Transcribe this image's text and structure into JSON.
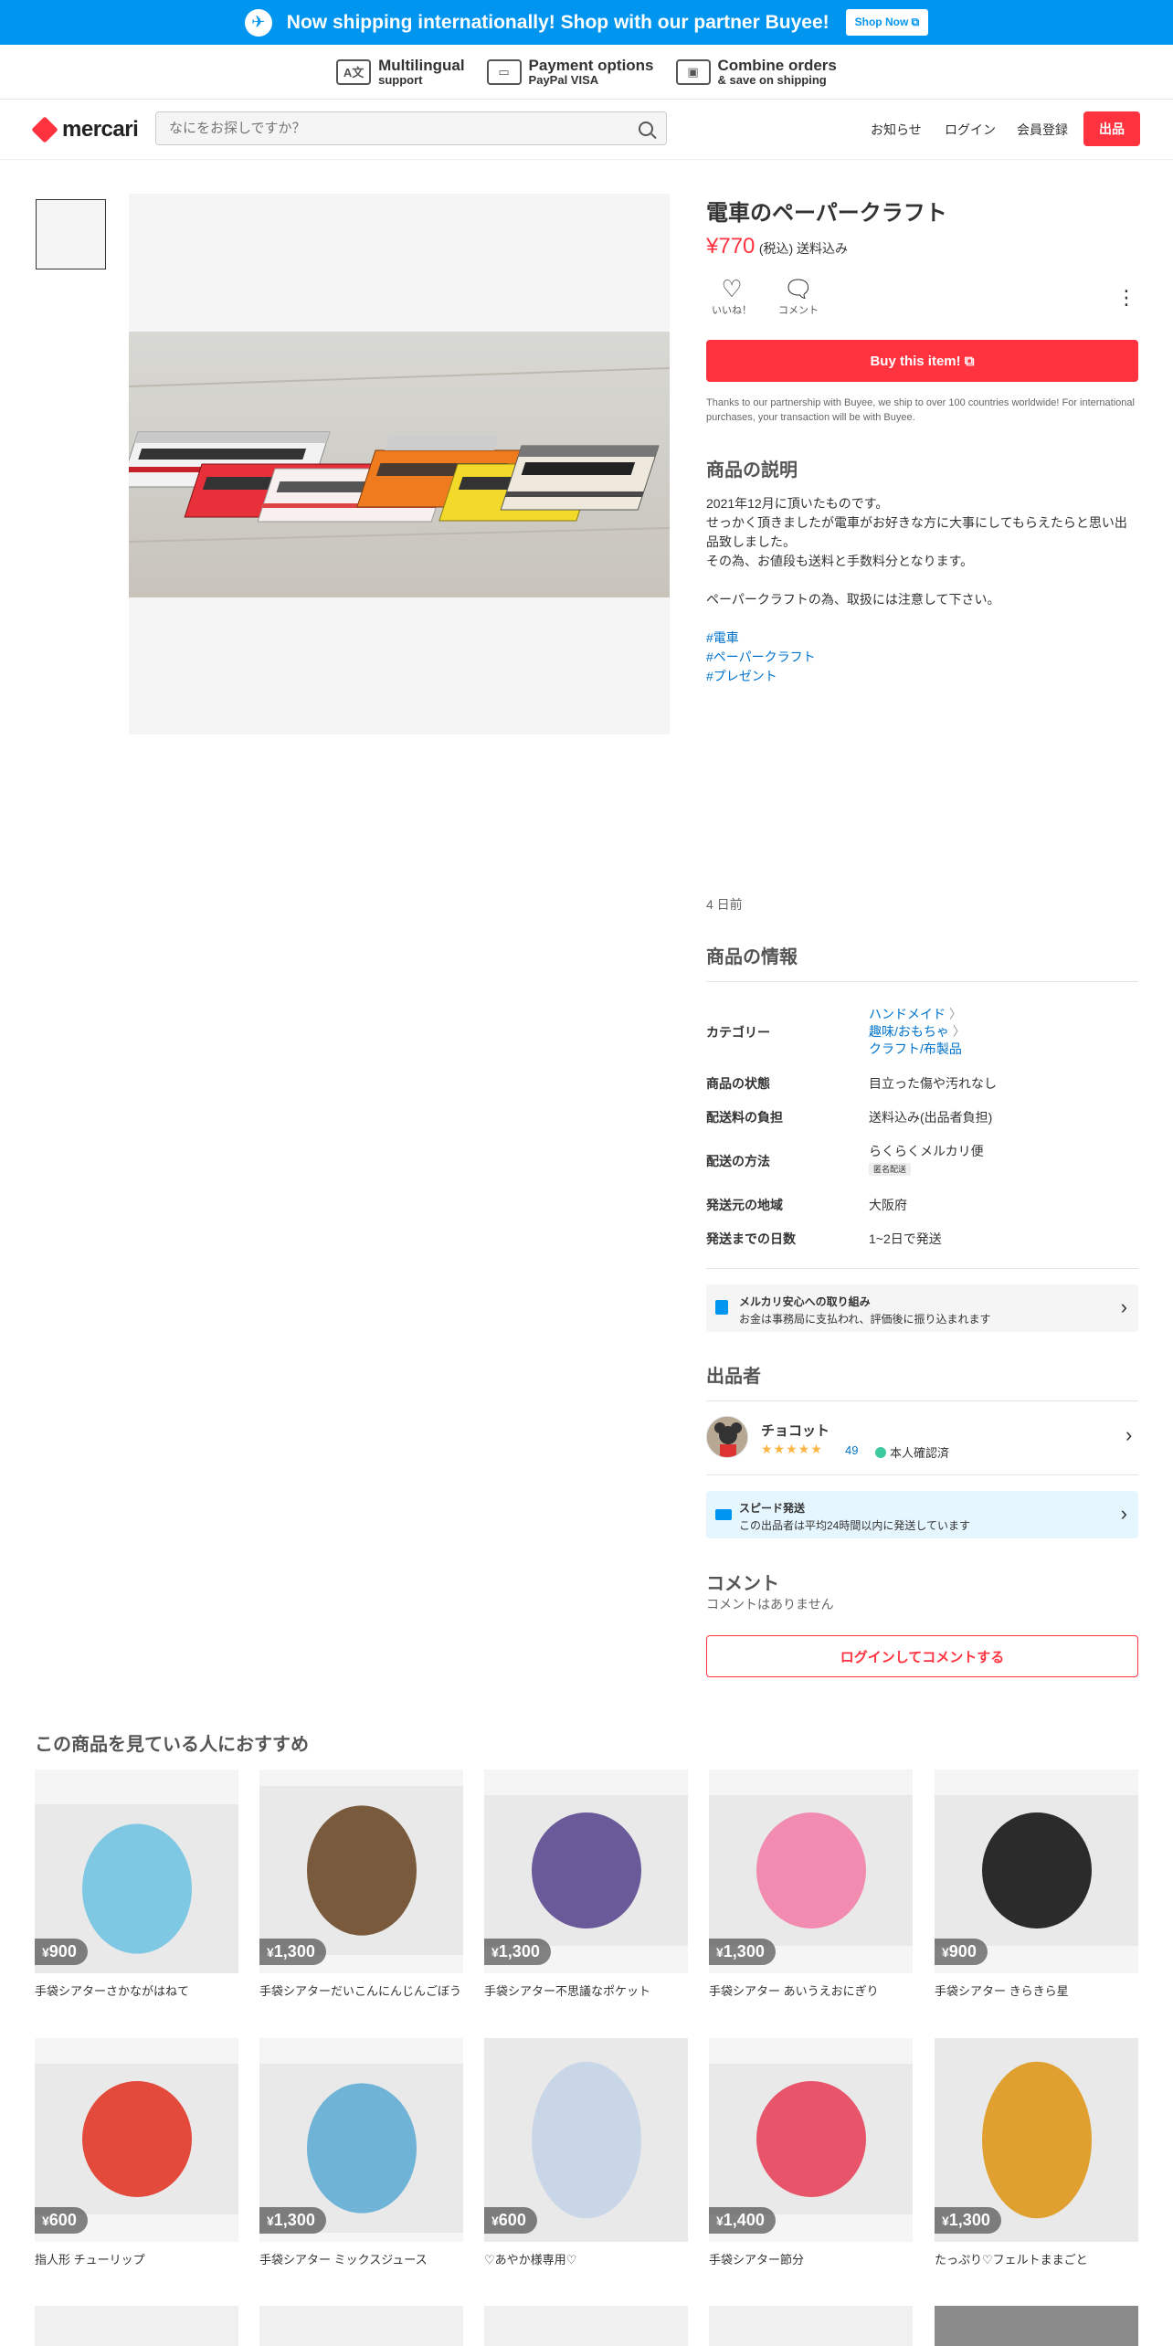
{
  "banner": {
    "message": "Now shipping internationally! Shop with our partner Buyee!",
    "shop_now": "Shop Now"
  },
  "features": [
    {
      "title": "Multilingual",
      "sub": "support",
      "icon": "language-icon",
      "glyph": "A文"
    },
    {
      "title": "Payment options",
      "sub": "PayPal VISA",
      "icon": "payment-icon",
      "glyph": "▭"
    },
    {
      "title": "Combine orders",
      "sub": "& save on shipping",
      "icon": "box-icon",
      "glyph": "▣"
    }
  ],
  "header": {
    "logo": "mercari",
    "search_placeholder": "なにをお探しですか？",
    "nav": [
      "お知らせ",
      "ログイン",
      "会員登録"
    ],
    "sell": "出品"
  },
  "item": {
    "title": "電車のペーパークラフト",
    "price": "¥770",
    "tax": "(税込) 送料込み",
    "like": "いいね！",
    "comment": "コメント",
    "buy": "Buy this item!",
    "note": "Thanks to our partnership with Buyee, we ship to over 100 countries worldwide! For international purchases, your transaction will be with Buyee.",
    "desc_heading": "商品の説明",
    "description": "2021年12月に頂いたものです。\nせっかく頂きましたが電車がお好きな方に大事にしてもらえたらと思い出品致しました。\nその為、お値段も送料と手数料分となります。\n\nペーパークラフトの為、取扱には注意して下さい。",
    "tags": [
      "#電車",
      "#ペーパークラフト",
      "#プレゼント"
    ],
    "posted": "4 日前",
    "info_heading": "商品の情報",
    "category_label": "カテゴリー",
    "categories": [
      "ハンドメイド",
      "趣味/おもちゃ",
      "クラフト/布製品"
    ],
    "info": [
      {
        "label": "商品の状態",
        "value": "目立った傷や汚れなし"
      },
      {
        "label": "配送料の負担",
        "value": "送料込み(出品者負担)"
      },
      {
        "label": "配送の方法",
        "value": "らくらくメルカリ便",
        "pill": "匿名配送"
      },
      {
        "label": "発送元の地域",
        "value": "大阪府"
      },
      {
        "label": "発送までの日数",
        "value": "1~2日で発送"
      }
    ]
  },
  "safety": {
    "title": "メルカリ安心への取り組み",
    "text": "お金は事務局に支払われ、評価後に振り込まれます"
  },
  "seller": {
    "heading": "出品者",
    "name": "チョコット",
    "stars": "★★★★★",
    "rating": "49",
    "verified": "本人確認済"
  },
  "speed": {
    "title": "スピード発送",
    "text": "この出品者は平均24時間以内に発送しています"
  },
  "comments": {
    "heading": "コメント",
    "empty": "コメントはありません",
    "button": "ログインしてコメントする"
  },
  "recommend": {
    "heading": "この商品を見ている人におすすめ",
    "items": [
      {
        "price": "900",
        "name": "手袋シアターさかながはねて",
        "color": "#7ec8e3"
      },
      {
        "price": "1,300",
        "name": "手袋シアターだいこんにんじんごぼう",
        "color": "#7a5a3c"
      },
      {
        "price": "1,300",
        "name": "手袋シアター不思議なポケット",
        "color": "#6a5a9a"
      },
      {
        "price": "1,300",
        "name": "手袋シアター あいうえおにぎり",
        "color": "#f28bb0"
      },
      {
        "price": "900",
        "name": "手袋シアター きらきら星",
        "color": "#2b2b2b"
      },
      {
        "price": "600",
        "name": "指人形 チューリップ",
        "color": "#e34a3c"
      },
      {
        "price": "1,300",
        "name": "手袋シアター ミックスジュース",
        "color": "#6fb3d6"
      },
      {
        "price": "600",
        "name": "♡あやか様専用♡",
        "color": "#c9d6e8"
      },
      {
        "price": "1,400",
        "name": "手袋シアター節分",
        "color": "#e8546a"
      },
      {
        "price": "1,300",
        "name": "たっぷり♡フェルトままごと",
        "color": "#e0a030"
      }
    ]
  }
}
